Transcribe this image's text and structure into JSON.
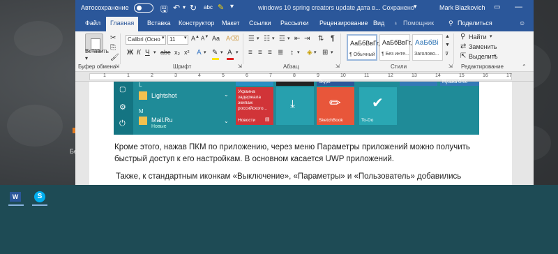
{
  "titlebar": {
    "autosave_label": "Автосохранение",
    "autosave_state": "Откл.",
    "document_title": "windows 10 spring creators update дата в...",
    "saved_status": "Сохранено",
    "user_name": "Mark Blazkovich"
  },
  "tabs": {
    "file": "Файл",
    "home": "Главная",
    "insert": "Вставка",
    "design": "Конструктор",
    "layout": "Макет",
    "references": "Ссылки",
    "mailings": "Рассылки",
    "review": "Рецензирование",
    "view": "Вид",
    "help": "Помощник",
    "share": "Поделиться"
  },
  "ribbon": {
    "paste_label": "Вставить",
    "font_name": "Calibri (Осно",
    "font_size": "11",
    "styles": [
      {
        "preview": "АаБбВвГг,",
        "name": "¶ Обычный"
      },
      {
        "preview": "АаБбВвГг,",
        "name": "¶ Без инте..."
      },
      {
        "preview": "АаБбВі",
        "name": "Заголово..."
      }
    ],
    "find_label": "Найти",
    "replace_label": "Заменить",
    "select_label": "Выделить"
  },
  "groups": {
    "clipboard": "Буфер обмена",
    "font": "Шрифт",
    "paragraph": "Абзац",
    "styles": "Стили",
    "editing": "Редактирование"
  },
  "startmenu": {
    "letter_l": "L",
    "lightshot": "Lightshot",
    "letter_m": "M",
    "mailru": "Mail.Ru",
    "mailru_sub": "Новые",
    "news_text": "Украина задержала экипаж российского...",
    "news_label": "Новости",
    "skype_label": "Skype",
    "sketchbook_label": "SketchBook",
    "todo_label": "To-Do",
    "music_label": "Музыка Groo"
  },
  "document": {
    "para1_line1": "Кроме этого, нажав ПКМ по приложению, через меню Параметры приложений можно получить",
    "para1_line2": "быстрый доступ к его настройкам. В основном касается UWP приложений.",
    "para2_line1": "Также, к стандартным иконкам «Выключение», «Параметры» и «Пользователь» добавились"
  },
  "colors": {
    "word_blue": "#2b579a",
    "tile_teal": "#2aa7b3",
    "news_red": "#d13438",
    "sketch_orange": "#e8563a",
    "taskbar": "#1e4b55"
  }
}
